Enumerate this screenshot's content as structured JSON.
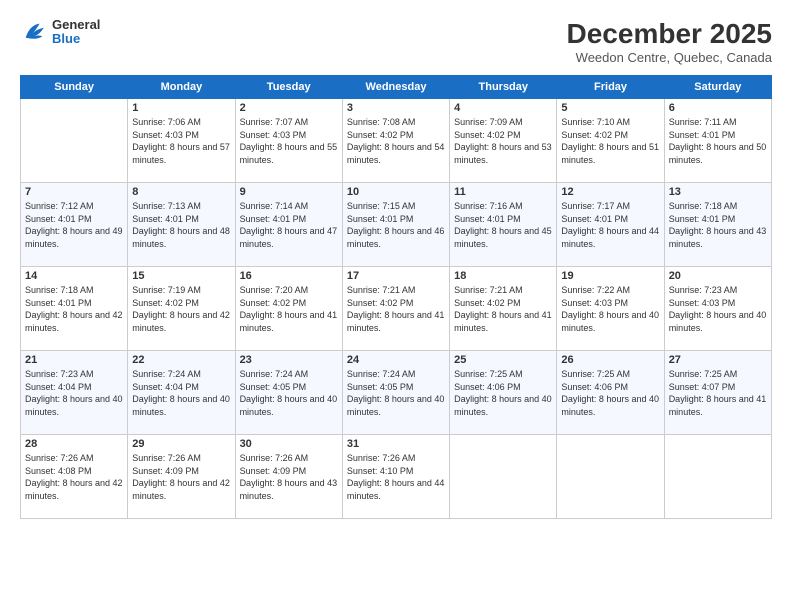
{
  "header": {
    "logo": {
      "general": "General",
      "blue": "Blue"
    },
    "title": "December 2025",
    "location": "Weedon Centre, Quebec, Canada"
  },
  "weekdays": [
    "Sunday",
    "Monday",
    "Tuesday",
    "Wednesday",
    "Thursday",
    "Friday",
    "Saturday"
  ],
  "weeks": [
    [
      {
        "day": "",
        "sunrise": "",
        "sunset": "",
        "daylight": ""
      },
      {
        "day": "1",
        "sunrise": "Sunrise: 7:06 AM",
        "sunset": "Sunset: 4:03 PM",
        "daylight": "Daylight: 8 hours and 57 minutes."
      },
      {
        "day": "2",
        "sunrise": "Sunrise: 7:07 AM",
        "sunset": "Sunset: 4:03 PM",
        "daylight": "Daylight: 8 hours and 55 minutes."
      },
      {
        "day": "3",
        "sunrise": "Sunrise: 7:08 AM",
        "sunset": "Sunset: 4:02 PM",
        "daylight": "Daylight: 8 hours and 54 minutes."
      },
      {
        "day": "4",
        "sunrise": "Sunrise: 7:09 AM",
        "sunset": "Sunset: 4:02 PM",
        "daylight": "Daylight: 8 hours and 53 minutes."
      },
      {
        "day": "5",
        "sunrise": "Sunrise: 7:10 AM",
        "sunset": "Sunset: 4:02 PM",
        "daylight": "Daylight: 8 hours and 51 minutes."
      },
      {
        "day": "6",
        "sunrise": "Sunrise: 7:11 AM",
        "sunset": "Sunset: 4:01 PM",
        "daylight": "Daylight: 8 hours and 50 minutes."
      }
    ],
    [
      {
        "day": "7",
        "sunrise": "Sunrise: 7:12 AM",
        "sunset": "Sunset: 4:01 PM",
        "daylight": "Daylight: 8 hours and 49 minutes."
      },
      {
        "day": "8",
        "sunrise": "Sunrise: 7:13 AM",
        "sunset": "Sunset: 4:01 PM",
        "daylight": "Daylight: 8 hours and 48 minutes."
      },
      {
        "day": "9",
        "sunrise": "Sunrise: 7:14 AM",
        "sunset": "Sunset: 4:01 PM",
        "daylight": "Daylight: 8 hours and 47 minutes."
      },
      {
        "day": "10",
        "sunrise": "Sunrise: 7:15 AM",
        "sunset": "Sunset: 4:01 PM",
        "daylight": "Daylight: 8 hours and 46 minutes."
      },
      {
        "day": "11",
        "sunrise": "Sunrise: 7:16 AM",
        "sunset": "Sunset: 4:01 PM",
        "daylight": "Daylight: 8 hours and 45 minutes."
      },
      {
        "day": "12",
        "sunrise": "Sunrise: 7:17 AM",
        "sunset": "Sunset: 4:01 PM",
        "daylight": "Daylight: 8 hours and 44 minutes."
      },
      {
        "day": "13",
        "sunrise": "Sunrise: 7:18 AM",
        "sunset": "Sunset: 4:01 PM",
        "daylight": "Daylight: 8 hours and 43 minutes."
      }
    ],
    [
      {
        "day": "14",
        "sunrise": "Sunrise: 7:18 AM",
        "sunset": "Sunset: 4:01 PM",
        "daylight": "Daylight: 8 hours and 42 minutes."
      },
      {
        "day": "15",
        "sunrise": "Sunrise: 7:19 AM",
        "sunset": "Sunset: 4:02 PM",
        "daylight": "Daylight: 8 hours and 42 minutes."
      },
      {
        "day": "16",
        "sunrise": "Sunrise: 7:20 AM",
        "sunset": "Sunset: 4:02 PM",
        "daylight": "Daylight: 8 hours and 41 minutes."
      },
      {
        "day": "17",
        "sunrise": "Sunrise: 7:21 AM",
        "sunset": "Sunset: 4:02 PM",
        "daylight": "Daylight: 8 hours and 41 minutes."
      },
      {
        "day": "18",
        "sunrise": "Sunrise: 7:21 AM",
        "sunset": "Sunset: 4:02 PM",
        "daylight": "Daylight: 8 hours and 41 minutes."
      },
      {
        "day": "19",
        "sunrise": "Sunrise: 7:22 AM",
        "sunset": "Sunset: 4:03 PM",
        "daylight": "Daylight: 8 hours and 40 minutes."
      },
      {
        "day": "20",
        "sunrise": "Sunrise: 7:23 AM",
        "sunset": "Sunset: 4:03 PM",
        "daylight": "Daylight: 8 hours and 40 minutes."
      }
    ],
    [
      {
        "day": "21",
        "sunrise": "Sunrise: 7:23 AM",
        "sunset": "Sunset: 4:04 PM",
        "daylight": "Daylight: 8 hours and 40 minutes."
      },
      {
        "day": "22",
        "sunrise": "Sunrise: 7:24 AM",
        "sunset": "Sunset: 4:04 PM",
        "daylight": "Daylight: 8 hours and 40 minutes."
      },
      {
        "day": "23",
        "sunrise": "Sunrise: 7:24 AM",
        "sunset": "Sunset: 4:05 PM",
        "daylight": "Daylight: 8 hours and 40 minutes."
      },
      {
        "day": "24",
        "sunrise": "Sunrise: 7:24 AM",
        "sunset": "Sunset: 4:05 PM",
        "daylight": "Daylight: 8 hours and 40 minutes."
      },
      {
        "day": "25",
        "sunrise": "Sunrise: 7:25 AM",
        "sunset": "Sunset: 4:06 PM",
        "daylight": "Daylight: 8 hours and 40 minutes."
      },
      {
        "day": "26",
        "sunrise": "Sunrise: 7:25 AM",
        "sunset": "Sunset: 4:06 PM",
        "daylight": "Daylight: 8 hours and 40 minutes."
      },
      {
        "day": "27",
        "sunrise": "Sunrise: 7:25 AM",
        "sunset": "Sunset: 4:07 PM",
        "daylight": "Daylight: 8 hours and 41 minutes."
      }
    ],
    [
      {
        "day": "28",
        "sunrise": "Sunrise: 7:26 AM",
        "sunset": "Sunset: 4:08 PM",
        "daylight": "Daylight: 8 hours and 42 minutes."
      },
      {
        "day": "29",
        "sunrise": "Sunrise: 7:26 AM",
        "sunset": "Sunset: 4:09 PM",
        "daylight": "Daylight: 8 hours and 42 minutes."
      },
      {
        "day": "30",
        "sunrise": "Sunrise: 7:26 AM",
        "sunset": "Sunset: 4:09 PM",
        "daylight": "Daylight: 8 hours and 43 minutes."
      },
      {
        "day": "31",
        "sunrise": "Sunrise: 7:26 AM",
        "sunset": "Sunset: 4:10 PM",
        "daylight": "Daylight: 8 hours and 44 minutes."
      },
      {
        "day": "",
        "sunrise": "",
        "sunset": "",
        "daylight": ""
      },
      {
        "day": "",
        "sunrise": "",
        "sunset": "",
        "daylight": ""
      },
      {
        "day": "",
        "sunrise": "",
        "sunset": "",
        "daylight": ""
      }
    ]
  ]
}
